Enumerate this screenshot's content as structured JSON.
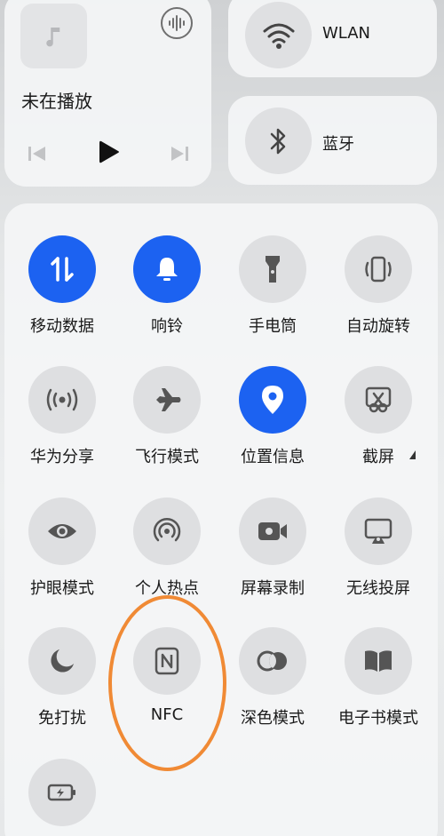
{
  "media": {
    "title": "未在播放",
    "icons": {
      "album": "music-note-icon",
      "sound": "sound-wave-icon",
      "prev": "skip-previous-icon",
      "play": "play-icon",
      "next": "skip-next-icon"
    }
  },
  "wlan": {
    "label": "WLAN",
    "icon": "wifi-icon"
  },
  "bluetooth": {
    "label": "蓝牙",
    "icon": "bluetooth-icon"
  },
  "tiles": [
    {
      "label": "移动数据",
      "icon": "mobile-data-icon",
      "active": true
    },
    {
      "label": "响铃",
      "icon": "bell-icon",
      "active": true
    },
    {
      "label": "手电筒",
      "icon": "flashlight-icon",
      "active": false
    },
    {
      "label": "自动旋转",
      "icon": "auto-rotate-icon",
      "active": false
    },
    {
      "label": "华为分享",
      "icon": "huawei-share-icon",
      "active": false
    },
    {
      "label": "飞行模式",
      "icon": "airplane-icon",
      "active": false
    },
    {
      "label": "位置信息",
      "icon": "location-icon",
      "active": true
    },
    {
      "label": "截屏",
      "icon": "screenshot-icon",
      "active": false
    },
    {
      "label": "护眼模式",
      "icon": "eye-icon",
      "active": false
    },
    {
      "label": "个人热点",
      "icon": "hotspot-icon",
      "active": false
    },
    {
      "label": "屏幕录制",
      "icon": "screen-record-icon",
      "active": false
    },
    {
      "label": "无线投屏",
      "icon": "wireless-projection-icon",
      "active": false
    },
    {
      "label": "免打扰",
      "icon": "moon-icon",
      "active": false
    },
    {
      "label": "NFC",
      "icon": "nfc-icon",
      "active": false
    },
    {
      "label": "深色模式",
      "icon": "dark-mode-icon",
      "active": false
    },
    {
      "label": "电子书模式",
      "icon": "ebook-icon",
      "active": false
    },
    {
      "label": "",
      "icon": "battery-saver-icon",
      "active": false
    }
  ],
  "colors": {
    "active": "#1c62f1",
    "inactive": "#dedfe1",
    "annotation": "#f08a35"
  }
}
